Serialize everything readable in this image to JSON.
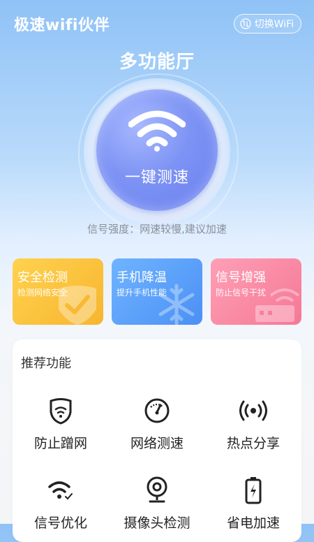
{
  "header": {
    "app_title": "极速wifi伙伴",
    "switch_label": "切换WiFi"
  },
  "hero": {
    "title": "多功能厅",
    "speed_button_label": "一键测速",
    "signal_status": "信号强度：网速较慢,建议加速"
  },
  "cards": [
    {
      "title": "安全检测",
      "subtitle": "检测网络安全",
      "color": "#f9c23c",
      "icon": "checkmark-icon"
    },
    {
      "title": "手机降温",
      "subtitle": "提升手机性能",
      "color": "#5aa3fa",
      "icon": "snowflake-icon"
    },
    {
      "title": "信号增强",
      "subtitle": "防止信号干扰",
      "color": "#f88aa4",
      "icon": "router-icon"
    }
  ],
  "recommend": {
    "title": "推荐功能",
    "items": [
      {
        "label": "防止蹭网",
        "icon": "shield-wifi-icon"
      },
      {
        "label": "网络测速",
        "icon": "speedometer-icon"
      },
      {
        "label": "热点分享",
        "icon": "hotspot-icon"
      },
      {
        "label": "信号优化",
        "icon": "wifi-check-icon"
      },
      {
        "label": "摄像头检测",
        "icon": "camera-icon"
      },
      {
        "label": "省电加速",
        "icon": "battery-icon"
      }
    ]
  }
}
